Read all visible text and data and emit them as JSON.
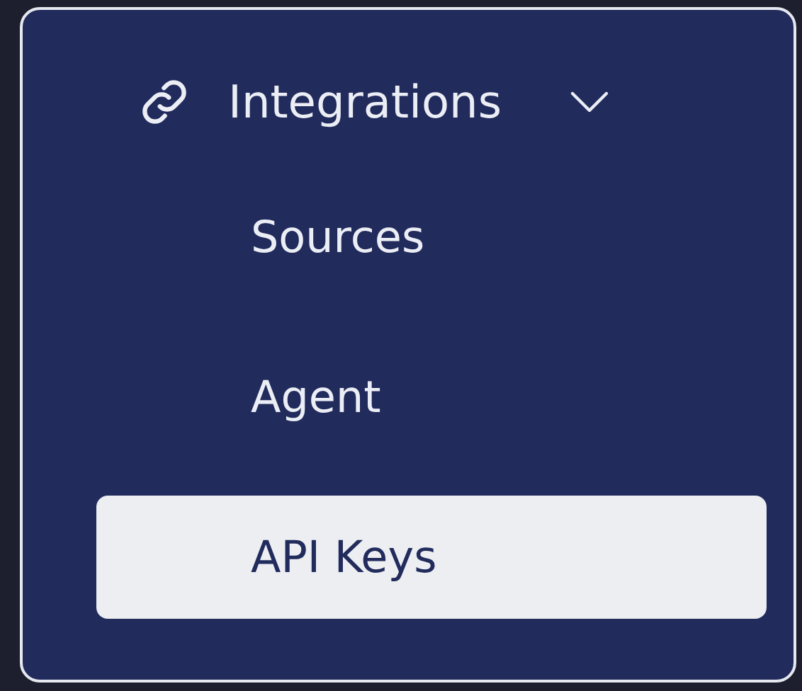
{
  "group": {
    "label": "Integrations",
    "expanded": true
  },
  "items": [
    {
      "label": "Sources",
      "selected": false
    },
    {
      "label": "Agent",
      "selected": false
    },
    {
      "label": "API Keys",
      "selected": true
    }
  ]
}
